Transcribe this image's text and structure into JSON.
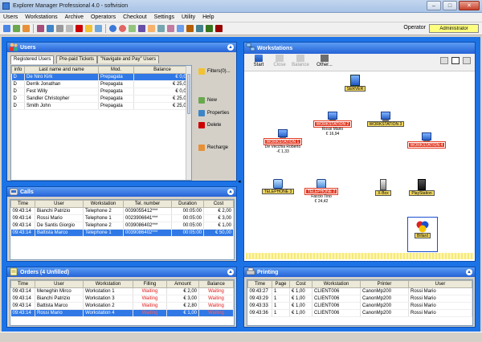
{
  "app": {
    "title": "Explorer Manager Professional 4.0 - softvision"
  },
  "window_buttons": {
    "minimize": "–",
    "maximize": "□",
    "close": "✕"
  },
  "menu": [
    "Users",
    "Workstations",
    "Archive",
    "Operators",
    "Checkout",
    "Settings",
    "Utility",
    "Help"
  ],
  "toolbar_icons": [
    "user-icon",
    "users-icon",
    "archive-icon",
    "box-icon",
    "calendar-icon",
    "doc-icon",
    "doc2-icon",
    "chart-icon",
    "list-icon",
    "list2-icon",
    "help-icon",
    "clock-icon",
    "card-icon",
    "save-icon",
    "folder-icon",
    "print-icon",
    "mail-icon",
    "phone-icon",
    "key-icon",
    "network-icon",
    "lock-icon",
    "exit-icon"
  ],
  "operator": {
    "label": "Operator",
    "value": "Administrator"
  },
  "users": {
    "title": "Users",
    "tabs": [
      "Registered Users",
      "Pre-paid Tickets",
      "\"Navigate and Pay\" Users"
    ],
    "columns": [
      "info",
      "Last name and name",
      "Mod.",
      "Balance"
    ],
    "rows": [
      {
        "info": "D",
        "name": "De Niro Kirk",
        "mod": "Prepagata",
        "balance": "€ 0,00",
        "selected": true
      },
      {
        "info": "D",
        "name": "Derrik Jonathan",
        "mod": "Prepagata",
        "balance": "€ 25,00",
        "selected": false
      },
      {
        "info": "D",
        "name": "Fest Willy",
        "mod": "Prepagata",
        "balance": "€ 0,00",
        "selected": false
      },
      {
        "info": "D",
        "name": "Sandler Christopher",
        "mod": "Prepagata",
        "balance": "€ 25,00",
        "selected": false
      },
      {
        "info": "D",
        "name": "Smith John",
        "mod": "Prepagata",
        "balance": "€ 25,00",
        "selected": false
      }
    ],
    "actions": {
      "filters": "Filters(0)...",
      "new": "New",
      "properties": "Properties",
      "delete": "Delete",
      "recharge": "Recharge"
    }
  },
  "calls": {
    "title": "Calls",
    "columns": [
      "Time",
      "User",
      "Workstation",
      "Tel. number",
      "Duration",
      "Cost"
    ],
    "rows": [
      {
        "time": "09:43:14",
        "user": "Bianchi Patrizio",
        "ws": "Telephone 2",
        "tel": "0039055412***",
        "dur": "00:05:00",
        "cost": "€ 2,00",
        "selected": false
      },
      {
        "time": "09:43:14",
        "user": "Rossi Mario",
        "ws": "Telephone 1",
        "tel": "0023906641***",
        "dur": "00:05:00",
        "cost": "€ 3,00",
        "selected": false
      },
      {
        "time": "09:43:14",
        "user": "De Santis Giorgio",
        "ws": "Telephone 2",
        "tel": "0039086402***",
        "dur": "00:05:00",
        "cost": "€ 1,00",
        "selected": false
      },
      {
        "time": "09:43:14",
        "user": "Battista Marco",
        "ws": "Telephone 1",
        "tel": "0039086402***",
        "dur": "00:05:00",
        "cost": "€ 50,00",
        "selected": true
      }
    ]
  },
  "orders": {
    "title": "Orders (4 Unfilled)",
    "columns": [
      "Time",
      "User",
      "Workstation",
      "Filling",
      "Amount",
      "Balance"
    ],
    "rows": [
      {
        "time": "09:43:14",
        "user": "Meneghin Mirco",
        "ws": "Workstation 1",
        "filling": "Waiting",
        "amount": "€ 2,00",
        "balance": "Waiting",
        "selected": false
      },
      {
        "time": "09:43:14",
        "user": "Bianchi Patrizio",
        "ws": "Workstation 3",
        "filling": "Waiting",
        "amount": "€ 3,00",
        "balance": "Waiting",
        "selected": false
      },
      {
        "time": "09:43:14",
        "user": "Battista Marco",
        "ws": "Workstation 2",
        "filling": "Waiting",
        "amount": "€ 2,80",
        "balance": "Waiting",
        "selected": false
      },
      {
        "time": "09:43:14",
        "user": "Rossi Mario",
        "ws": "Workstation 4",
        "filling": "Waiting",
        "amount": "€ 1,00",
        "balance": "Waiting",
        "selected": true
      }
    ]
  },
  "workstations": {
    "title": "Workstations",
    "toolbar": {
      "start": "Start",
      "close": "Close",
      "balance": "Balance",
      "other": "Other..."
    },
    "nodes": {
      "server": {
        "label": "SERVER"
      },
      "ws1": {
        "label": "WORKSTATION 1",
        "user": "De Vecchia Roberto",
        "amount": "-€ 1,33"
      },
      "ws2": {
        "label": "WORKSTATION 2",
        "user": "Rossi Mario",
        "amount": "€ 16,94"
      },
      "ws3": {
        "label": "WORKSTATION 3"
      },
      "ws4": {
        "label": "WORKSTATION 4"
      },
      "tel3": {
        "label": "TELEPHONE 3"
      },
      "tel2": {
        "label": "TELEPHONE 2",
        "user": "Faccio Tino",
        "amount": "€ 24,42"
      },
      "xbox": {
        "label": "X-Box"
      },
      "ps": {
        "label": "PlayStation"
      },
      "billard": {
        "label": "Billard"
      }
    }
  },
  "printing": {
    "title": "Printing",
    "columns": [
      "Time",
      "Page",
      "Cost",
      "Workstation",
      "Printer",
      "User"
    ],
    "rows": [
      {
        "time": "09:43:27",
        "page": "1",
        "cost": "€ 1,00",
        "ws": "CLIENT006",
        "printer": "CanonMp200",
        "user": "Rossi Mario"
      },
      {
        "time": "09:43:29",
        "page": "1",
        "cost": "€ 1,00",
        "ws": "CLIENT006",
        "printer": "CanonMp200",
        "user": "Rossi Mario"
      },
      {
        "time": "09:43:33",
        "page": "1",
        "cost": "€ 1,00",
        "ws": "CLIENT006",
        "printer": "CanonMp200",
        "user": "Rossi Mario"
      },
      {
        "time": "09:43:36",
        "page": "1",
        "cost": "€ 1,00",
        "ws": "CLIENT006",
        "printer": "CanonMp200",
        "user": "Rossi Mario"
      }
    ]
  },
  "colors": {
    "frame": "#1c73e6",
    "header": "#2563d6",
    "selection": "#2f78e6",
    "red_label": "#e33a22",
    "yellow_label": "#f2d860",
    "waiting": "#e01a1a"
  }
}
